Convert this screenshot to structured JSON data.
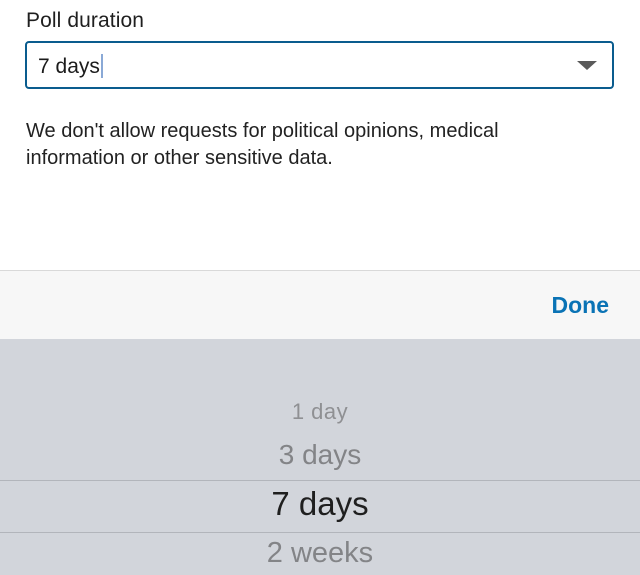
{
  "form": {
    "label": "Poll duration",
    "selected_value": "7 days",
    "notice": "We don't allow requests for political opinions, medical information or other sensitive data."
  },
  "toolbar": {
    "done_label": "Done"
  },
  "picker": {
    "options": [
      "1 day",
      "3 days",
      "7 days",
      "2 weeks"
    ],
    "selected_index": 2
  },
  "colors": {
    "accent": "#0a73b5",
    "field_border": "#0a5c8e",
    "picker_background": "#d2d5db"
  }
}
